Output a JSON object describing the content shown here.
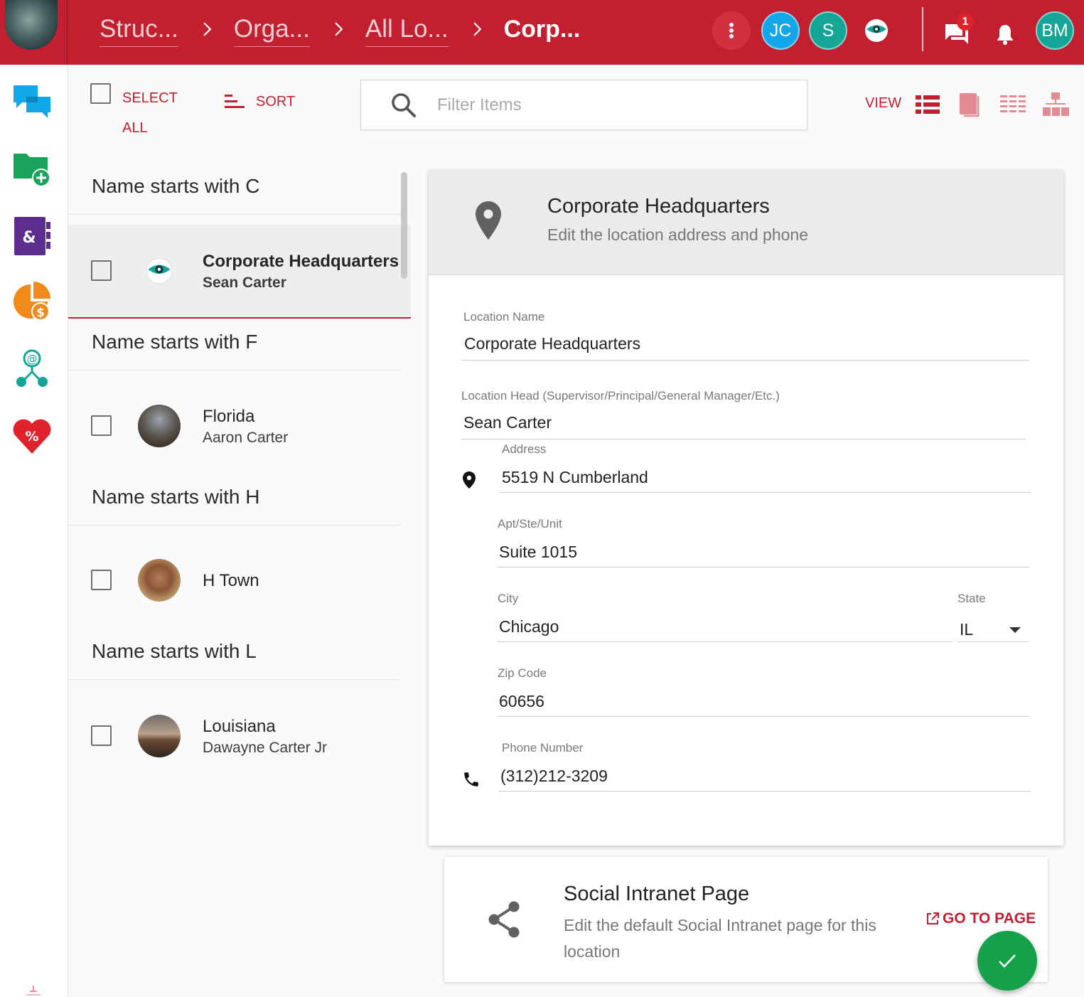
{
  "breadcrumbs": [
    {
      "label": "Struc..."
    },
    {
      "label": "Orga..."
    },
    {
      "label": "All Lo..."
    },
    {
      "label": "Corp..."
    }
  ],
  "header": {
    "avatars": [
      {
        "initials": "JC",
        "color": "#13a7e8"
      },
      {
        "initials": "S",
        "color": "#14a597"
      }
    ],
    "chat_badge": "1",
    "user_initials": "BM",
    "brand_color": "#c21f30"
  },
  "toolbar": {
    "select_all": "SELECT\nALL",
    "sort": "SORT",
    "filter_placeholder": "Filter Items",
    "view": "VIEW"
  },
  "list": {
    "groups": [
      {
        "heading": "Name starts with C",
        "items": [
          {
            "title": "Corporate Headquarters",
            "subtitle": "Sean Carter",
            "selected": true
          }
        ]
      },
      {
        "heading": "Name starts with F",
        "items": [
          {
            "title": "Florida",
            "subtitle": "Aaron Carter"
          }
        ]
      },
      {
        "heading": "Name starts with H",
        "items": [
          {
            "title": "H Town",
            "subtitle": ""
          }
        ]
      },
      {
        "heading": "Name starts with L",
        "items": [
          {
            "title": "Louisiana",
            "subtitle": "Dawayne Carter Jr"
          }
        ]
      }
    ]
  },
  "detail": {
    "title": "Corporate Headquarters",
    "subtitle": "Edit the location address and phone",
    "fields": {
      "location_name": {
        "label": "Location Name",
        "value": "Corporate Headquarters"
      },
      "location_head": {
        "label": "Location Head (Supervisor/Principal/General Manager/Etc.)",
        "value": "Sean Carter"
      },
      "address": {
        "label": "Address",
        "value": "5519 N Cumberland"
      },
      "apt": {
        "label": "Apt/Ste/Unit",
        "value": "Suite 1015"
      },
      "city": {
        "label": "City",
        "value": "Chicago"
      },
      "state": {
        "label": "State",
        "value": "IL"
      },
      "zip": {
        "label": "Zip Code",
        "value": "60656"
      },
      "phone": {
        "label": "Phone Number",
        "value": "(312)212-3209"
      }
    }
  },
  "social": {
    "title": "Social Intranet Page",
    "subtitle": "Edit the default Social Intranet page for this location",
    "action": "GO TO PAGE"
  }
}
